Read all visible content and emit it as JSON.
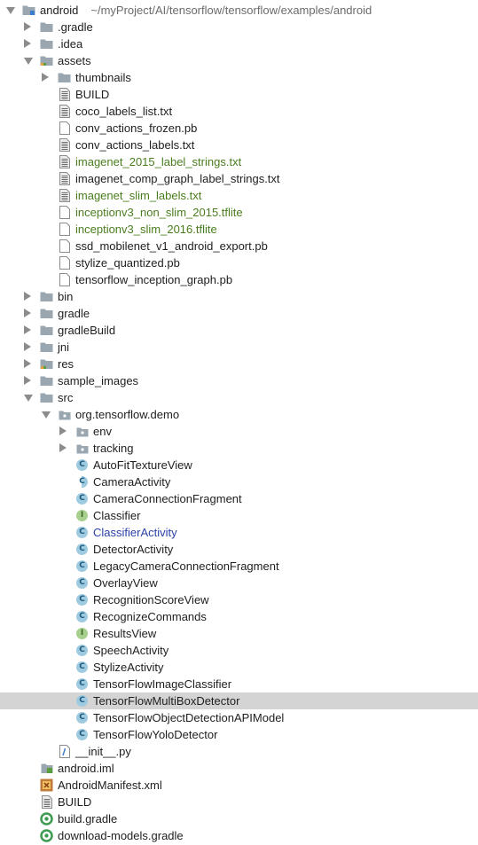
{
  "tree": {
    "root": {
      "name": "android",
      "path": "~/myProject/AI/tensorflow/tensorflow/examples/android"
    },
    "rows": [
      {
        "label": "android",
        "depth": 0,
        "arrow": "open",
        "icon": "folder-module"
      },
      {
        "label": ".gradle",
        "depth": 1,
        "arrow": "closed",
        "icon": "folder"
      },
      {
        "label": ".idea",
        "depth": 1,
        "arrow": "closed",
        "icon": "folder"
      },
      {
        "label": "assets",
        "depth": 1,
        "arrow": "open",
        "icon": "folder-resources"
      },
      {
        "label": "thumbnails",
        "depth": 2,
        "arrow": "closed",
        "icon": "folder"
      },
      {
        "label": "BUILD",
        "depth": 2,
        "arrow": "none",
        "icon": "text-file"
      },
      {
        "label": "coco_labels_list.txt",
        "depth": 2,
        "arrow": "none",
        "icon": "text-file"
      },
      {
        "label": "conv_actions_frozen.pb",
        "depth": 2,
        "arrow": "none",
        "icon": "blank-file"
      },
      {
        "label": "conv_actions_labels.txt",
        "depth": 2,
        "arrow": "none",
        "icon": "text-file"
      },
      {
        "label": "imagenet_2015_label_strings.txt",
        "depth": 2,
        "arrow": "none",
        "icon": "text-file",
        "color": "green"
      },
      {
        "label": "imagenet_comp_graph_label_strings.txt",
        "depth": 2,
        "arrow": "none",
        "icon": "text-file"
      },
      {
        "label": "imagenet_slim_labels.txt",
        "depth": 2,
        "arrow": "none",
        "icon": "text-file",
        "color": "green"
      },
      {
        "label": "inceptionv3_non_slim_2015.tflite",
        "depth": 2,
        "arrow": "none",
        "icon": "blank-file",
        "color": "green"
      },
      {
        "label": "inceptionv3_slim_2016.tflite",
        "depth": 2,
        "arrow": "none",
        "icon": "blank-file",
        "color": "green"
      },
      {
        "label": "ssd_mobilenet_v1_android_export.pb",
        "depth": 2,
        "arrow": "none",
        "icon": "blank-file"
      },
      {
        "label": "stylize_quantized.pb",
        "depth": 2,
        "arrow": "none",
        "icon": "blank-file"
      },
      {
        "label": "tensorflow_inception_graph.pb",
        "depth": 2,
        "arrow": "none",
        "icon": "blank-file"
      },
      {
        "label": "bin",
        "depth": 1,
        "arrow": "closed",
        "icon": "folder"
      },
      {
        "label": "gradle",
        "depth": 1,
        "arrow": "closed",
        "icon": "folder"
      },
      {
        "label": "gradleBuild",
        "depth": 1,
        "arrow": "closed",
        "icon": "folder"
      },
      {
        "label": "jni",
        "depth": 1,
        "arrow": "closed",
        "icon": "folder"
      },
      {
        "label": "res",
        "depth": 1,
        "arrow": "closed",
        "icon": "folder-resources"
      },
      {
        "label": "sample_images",
        "depth": 1,
        "arrow": "closed",
        "icon": "folder"
      },
      {
        "label": "src",
        "depth": 1,
        "arrow": "open",
        "icon": "folder"
      },
      {
        "label": "org.tensorflow.demo",
        "depth": 2,
        "arrow": "open",
        "icon": "package"
      },
      {
        "label": "env",
        "depth": 3,
        "arrow": "closed",
        "icon": "package"
      },
      {
        "label": "tracking",
        "depth": 3,
        "arrow": "closed",
        "icon": "package"
      },
      {
        "label": "AutoFitTextureView",
        "depth": 3,
        "arrow": "none",
        "icon": "class"
      },
      {
        "label": "CameraActivity",
        "depth": 3,
        "arrow": "none",
        "icon": "class-partial"
      },
      {
        "label": "CameraConnectionFragment",
        "depth": 3,
        "arrow": "none",
        "icon": "class"
      },
      {
        "label": "Classifier",
        "depth": 3,
        "arrow": "none",
        "icon": "interface"
      },
      {
        "label": "ClassifierActivity",
        "depth": 3,
        "arrow": "none",
        "icon": "class",
        "color": "blue"
      },
      {
        "label": "DetectorActivity",
        "depth": 3,
        "arrow": "none",
        "icon": "class"
      },
      {
        "label": "LegacyCameraConnectionFragment",
        "depth": 3,
        "arrow": "none",
        "icon": "class"
      },
      {
        "label": "OverlayView",
        "depth": 3,
        "arrow": "none",
        "icon": "class"
      },
      {
        "label": "RecognitionScoreView",
        "depth": 3,
        "arrow": "none",
        "icon": "class"
      },
      {
        "label": "RecognizeCommands",
        "depth": 3,
        "arrow": "none",
        "icon": "class"
      },
      {
        "label": "ResultsView",
        "depth": 3,
        "arrow": "none",
        "icon": "interface"
      },
      {
        "label": "SpeechActivity",
        "depth": 3,
        "arrow": "none",
        "icon": "class"
      },
      {
        "label": "StylizeActivity",
        "depth": 3,
        "arrow": "none",
        "icon": "class"
      },
      {
        "label": "TensorFlowImageClassifier",
        "depth": 3,
        "arrow": "none",
        "icon": "class"
      },
      {
        "label": "TensorFlowMultiBoxDetector",
        "depth": 3,
        "arrow": "none",
        "icon": "class",
        "selected": true
      },
      {
        "label": "TensorFlowObjectDetectionAPIModel",
        "depth": 3,
        "arrow": "none",
        "icon": "class"
      },
      {
        "label": "TensorFlowYoloDetector",
        "depth": 3,
        "arrow": "none",
        "icon": "class"
      },
      {
        "label": "__init__.py",
        "depth": 2,
        "arrow": "none",
        "icon": "python-file"
      },
      {
        "label": "android.iml",
        "depth": 1,
        "arrow": "none",
        "icon": "iml-file"
      },
      {
        "label": "AndroidManifest.xml",
        "depth": 1,
        "arrow": "none",
        "icon": "xml-file"
      },
      {
        "label": "BUILD",
        "depth": 1,
        "arrow": "none",
        "icon": "text-file"
      },
      {
        "label": "build.gradle",
        "depth": 1,
        "arrow": "none",
        "icon": "gradle-file"
      },
      {
        "label": "download-models.gradle",
        "depth": 1,
        "arrow": "none",
        "icon": "gradle-file"
      }
    ]
  },
  "colors": {
    "green_text": "#4a7d1e",
    "blue_text": "#2a42a8",
    "selection": "#d4d4d4",
    "folder": "#9aa7b0",
    "class_badge": "#9fcbe0",
    "interface_badge": "#a8cf8e"
  }
}
